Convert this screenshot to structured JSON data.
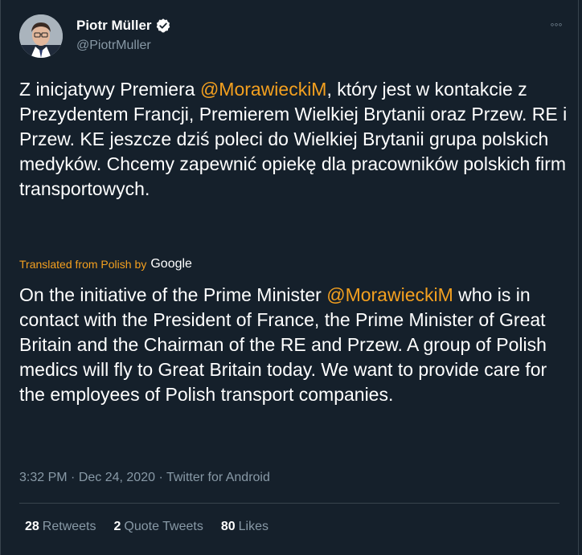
{
  "author": {
    "display_name": "Piotr Müller",
    "handle": "@PiotrMuller"
  },
  "more_label": "◦◦◦",
  "tweet": {
    "part1": "Z inicjatywy Premiera ",
    "mention": "@MorawieckiM",
    "part2": ", który jest w kontakcie z Prezydentem Francji, Premierem Wielkiej Brytanii oraz Przew. RE i Przew. KE jeszcze dziś poleci do Wielkiej Brytanii grupa polskich medyków. Chcemy zapewnić opiekę dla pracowników polskich firm transportowych."
  },
  "translation_notice": {
    "label": "Translated from Polish",
    "by": "by",
    "provider": "Google"
  },
  "translation": {
    "part1": "On the initiative of the Prime Minister ",
    "mention": "@MorawieckiM",
    "part2": " who is in contact with the President of France, the Prime Minister of Great Britain and the Chairman of the RE and Przew. A group of Polish medics will fly to Great Britain today. We want to provide care for the employees of Polish transport companies."
  },
  "meta": {
    "time": "3:32 PM",
    "separator": " · ",
    "date": "Dec 24, 2020",
    "source": "Twitter for Android"
  },
  "stats": {
    "retweets_count": "28",
    "retweets_label": "Retweets",
    "quotes_count": "2",
    "quotes_label": "Quote Tweets",
    "likes_count": "80",
    "likes_label": "Likes"
  },
  "colors": {
    "background": "#15202b",
    "accent": "#f4a01f",
    "muted": "#8899a6",
    "divider": "#38444d"
  }
}
